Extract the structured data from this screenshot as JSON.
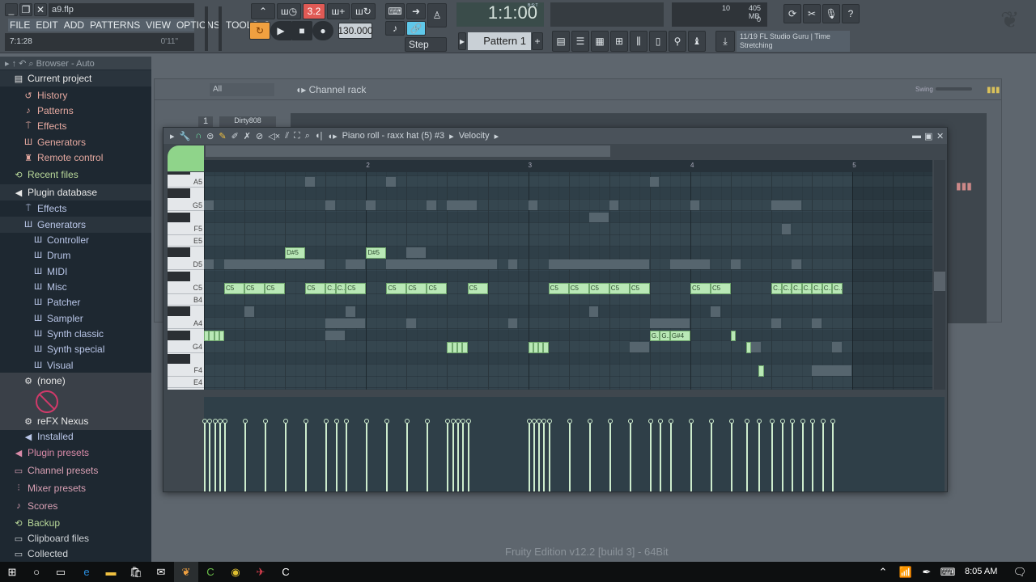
{
  "app": {
    "file": "a9.flp",
    "song_pos": "7:1:28",
    "time": "0'11\"",
    "tempo": "130.000",
    "pattern_mode_display": "3.2",
    "snap": "Step",
    "pattern": "Pattern 1",
    "bst": "1:1:00",
    "bst_label": "B:S:T",
    "cpu": "10",
    "memory": "405 MB",
    "polyphony": "0",
    "hint_counter": "11/19",
    "hint_text": "FL Studio Guru | Time Stretching",
    "version": "Fruity Edition v12.2 [build 3] - 64Bit"
  },
  "menu": [
    "FILE",
    "EDIT",
    "ADD",
    "PATTERNS",
    "VIEW",
    "OPTIONS",
    "TOOLS",
    "?"
  ],
  "browser": {
    "title": "Browser - Auto",
    "items": [
      {
        "label": "Current project",
        "icon": "page-icon",
        "indent": 0,
        "color": "#e8e8e8"
      },
      {
        "label": "History",
        "icon": "history-icon",
        "indent": 1,
        "color": "#e6a9a0"
      },
      {
        "label": "Patterns",
        "icon": "note-icon",
        "indent": 1,
        "color": "#e6a9a0"
      },
      {
        "label": "Effects",
        "icon": "plug-icon",
        "indent": 1,
        "color": "#e6a9a0"
      },
      {
        "label": "Generators",
        "icon": "keyboard-icon",
        "indent": 1,
        "color": "#e6a9a0"
      },
      {
        "label": "Remote control",
        "icon": "remote-icon",
        "indent": 1,
        "color": "#e6a9a0"
      },
      {
        "label": "Recent files",
        "icon": "folder-refresh-icon",
        "indent": 0,
        "color": "#b9d99a"
      },
      {
        "label": "Plugin database",
        "icon": "speaker-icon",
        "indent": 0,
        "color": "#e8e8e8"
      },
      {
        "label": "Effects",
        "icon": "plug-icon",
        "indent": 1,
        "color": "#b9c6e8"
      },
      {
        "label": "Generators",
        "icon": "keyboard-icon",
        "indent": 1,
        "color": "#b9c6e8"
      },
      {
        "label": "Controller",
        "icon": "keyboard-icon",
        "indent": 2,
        "color": "#b9c6e8"
      },
      {
        "label": "Drum",
        "icon": "keyboard-icon",
        "indent": 2,
        "color": "#b9c6e8"
      },
      {
        "label": "MIDI",
        "icon": "keyboard-icon",
        "indent": 2,
        "color": "#b9c6e8"
      },
      {
        "label": "Misc",
        "icon": "keyboard-icon",
        "indent": 2,
        "color": "#b9c6e8"
      },
      {
        "label": "Patcher",
        "icon": "keyboard-icon",
        "indent": 2,
        "color": "#b9c6e8"
      },
      {
        "label": "Sampler",
        "icon": "keyboard-icon",
        "indent": 2,
        "color": "#b9c6e8"
      },
      {
        "label": "Synth classic",
        "icon": "keyboard-icon",
        "indent": 2,
        "color": "#b9c6e8"
      },
      {
        "label": "Synth special",
        "icon": "keyboard-icon",
        "indent": 2,
        "color": "#b9c6e8"
      },
      {
        "label": "Visual",
        "icon": "keyboard-icon",
        "indent": 2,
        "color": "#b9c6e8"
      },
      {
        "label": "(none)",
        "icon": "gear-icon",
        "indent": 1,
        "color": "#e8e8e8"
      },
      {
        "label": "reFX Nexus",
        "icon": "gear-icon",
        "indent": 1,
        "color": "#e8e8e8"
      },
      {
        "label": "Installed",
        "icon": "speaker-icon",
        "indent": 1,
        "color": "#b9c6e8"
      },
      {
        "label": "Plugin presets",
        "icon": "speaker-icon",
        "indent": 0,
        "color": "#d98aa8"
      },
      {
        "label": "Channel presets",
        "icon": "channel-icon",
        "indent": 0,
        "color": "#d9a0b4"
      },
      {
        "label": "Mixer presets",
        "icon": "mixer-icon",
        "indent": 0,
        "color": "#d9a0b4"
      },
      {
        "label": "Scores",
        "icon": "note-icon",
        "indent": 0,
        "color": "#d9a0b4"
      },
      {
        "label": "Backup",
        "icon": "folder-refresh-icon",
        "indent": 0,
        "color": "#b9d99a"
      },
      {
        "label": "Clipboard files",
        "icon": "folder-icon",
        "indent": 0,
        "color": "#d0d4d8"
      },
      {
        "label": "Collected",
        "icon": "folder-icon",
        "indent": 0,
        "color": "#d0d4d8"
      }
    ]
  },
  "rack": {
    "filter": "All",
    "title": "Channel rack",
    "swing_label": "Swing",
    "channel_num": "1",
    "channel_name": "Dirty808"
  },
  "piano_roll": {
    "title": "Piano roll - raxx hat (5) #3",
    "target": "Velocity",
    "bars": [
      "2",
      "3",
      "4",
      "5"
    ],
    "keys": [
      "A5",
      "G5",
      "F5",
      "E5",
      "D5",
      "C5",
      "B4",
      "A4",
      "G4",
      "F4",
      "E4"
    ],
    "velocity": 100,
    "notes": [
      {
        "p": "G#4",
        "s": 0,
        "l": 0.5
      },
      {
        "p": "G#4",
        "s": 0.5,
        "l": 0.5
      },
      {
        "p": "G#4",
        "s": 1,
        "l": 0.5
      },
      {
        "p": "G#4",
        "s": 1.5,
        "l": 0.5
      },
      {
        "p": "C5",
        "s": 2,
        "l": 2
      },
      {
        "p": "C5",
        "s": 4,
        "l": 2
      },
      {
        "p": "C5",
        "s": 6,
        "l": 2
      },
      {
        "p": "D#5",
        "s": 8,
        "l": 2
      },
      {
        "p": "C5",
        "s": 10,
        "l": 2
      },
      {
        "p": "C5",
        "s": 12,
        "l": 1
      },
      {
        "p": "C5",
        "s": 13,
        "l": 1
      },
      {
        "p": "C5",
        "s": 14,
        "l": 2
      },
      {
        "p": "D#5",
        "s": 16,
        "l": 2
      },
      {
        "p": "C5",
        "s": 18,
        "l": 2
      },
      {
        "p": "C5",
        "s": 20,
        "l": 2
      },
      {
        "p": "C5",
        "s": 22,
        "l": 2
      },
      {
        "p": "G4",
        "s": 24,
        "l": 0.5
      },
      {
        "p": "G4",
        "s": 24.5,
        "l": 0.5
      },
      {
        "p": "G4",
        "s": 25,
        "l": 0.5
      },
      {
        "p": "G4",
        "s": 25.5,
        "l": 0.5
      },
      {
        "p": "C5",
        "s": 26,
        "l": 2
      },
      {
        "p": "G4",
        "s": 32,
        "l": 0.5
      },
      {
        "p": "G4",
        "s": 32.5,
        "l": 0.5
      },
      {
        "p": "G4",
        "s": 33,
        "l": 0.5
      },
      {
        "p": "G4",
        "s": 33.5,
        "l": 0.5
      },
      {
        "p": "C5",
        "s": 34,
        "l": 2
      },
      {
        "p": "C5",
        "s": 36,
        "l": 2
      },
      {
        "p": "C5",
        "s": 38,
        "l": 2
      },
      {
        "p": "C5",
        "s": 40,
        "l": 2
      },
      {
        "p": "C5",
        "s": 42,
        "l": 2
      },
      {
        "p": "G#4",
        "s": 44,
        "l": 1
      },
      {
        "p": "G#4",
        "s": 45,
        "l": 1
      },
      {
        "p": "G#4",
        "s": 46,
        "l": 2
      },
      {
        "p": "C5",
        "s": 48,
        "l": 2
      },
      {
        "p": "C5",
        "s": 50,
        "l": 2
      },
      {
        "p": "G#4",
        "s": 52,
        "l": 0.5
      },
      {
        "p": "G4",
        "s": 53.5,
        "l": 0.5
      },
      {
        "p": "F4",
        "s": 54.75,
        "l": 0.5
      },
      {
        "p": "C5",
        "s": 56,
        "l": 1
      },
      {
        "p": "C5",
        "s": 57,
        "l": 1
      },
      {
        "p": "C5",
        "s": 58,
        "l": 1
      },
      {
        "p": "C5",
        "s": 59,
        "l": 1
      },
      {
        "p": "C5",
        "s": 60,
        "l": 1
      },
      {
        "p": "C5",
        "s": 61,
        "l": 1
      },
      {
        "p": "C5",
        "s": 62,
        "l": 1
      }
    ],
    "ghost_notes": [
      {
        "p": "A5",
        "s": 10,
        "l": 1
      },
      {
        "p": "A5",
        "s": 18,
        "l": 1
      },
      {
        "p": "A5",
        "s": 44,
        "l": 1
      },
      {
        "p": "G5",
        "s": 0,
        "l": 1
      },
      {
        "p": "G5",
        "s": 12,
        "l": 1
      },
      {
        "p": "G5",
        "s": 16,
        "l": 1
      },
      {
        "p": "G5",
        "s": 22,
        "l": 1
      },
      {
        "p": "G5",
        "s": 24,
        "l": 3
      },
      {
        "p": "G5",
        "s": 32,
        "l": 1
      },
      {
        "p": "G5",
        "s": 40,
        "l": 1
      },
      {
        "p": "G5",
        "s": 48,
        "l": 1
      },
      {
        "p": "G5",
        "s": 56,
        "l": 3
      },
      {
        "p": "F#5",
        "s": 38,
        "l": 2
      },
      {
        "p": "F5",
        "s": 57,
        "l": 1
      },
      {
        "p": "D#5",
        "s": 20,
        "l": 2
      },
      {
        "p": "D5",
        "s": 0,
        "l": 1
      },
      {
        "p": "D5",
        "s": 2,
        "l": 10
      },
      {
        "p": "D5",
        "s": 14,
        "l": 2
      },
      {
        "p": "D5",
        "s": 18,
        "l": 11
      },
      {
        "p": "D5",
        "s": 30,
        "l": 1
      },
      {
        "p": "D5",
        "s": 34,
        "l": 10
      },
      {
        "p": "D5",
        "s": 46,
        "l": 4
      },
      {
        "p": "D5",
        "s": 52,
        "l": 1
      },
      {
        "p": "D5",
        "s": 58,
        "l": 1
      },
      {
        "p": "A#4",
        "s": 4,
        "l": 1
      },
      {
        "p": "A#4",
        "s": 14,
        "l": 1
      },
      {
        "p": "A#4",
        "s": 38,
        "l": 1
      },
      {
        "p": "A#4",
        "s": 50,
        "l": 1
      },
      {
        "p": "A4",
        "s": 12,
        "l": 4
      },
      {
        "p": "A4",
        "s": 20,
        "l": 1
      },
      {
        "p": "A4",
        "s": 30,
        "l": 1
      },
      {
        "p": "A4",
        "s": 44,
        "l": 4
      },
      {
        "p": "A4",
        "s": 56,
        "l": 1
      },
      {
        "p": "A4",
        "s": 60,
        "l": 1
      },
      {
        "p": "G#4",
        "s": 12,
        "l": 2
      },
      {
        "p": "G4",
        "s": 42,
        "l": 2
      },
      {
        "p": "G4",
        "s": 54,
        "l": 1
      },
      {
        "p": "G4",
        "s": 62,
        "l": 1
      },
      {
        "p": "F4",
        "s": 60,
        "l": 4
      }
    ]
  },
  "taskbar": {
    "clock": "8:05 AM"
  }
}
